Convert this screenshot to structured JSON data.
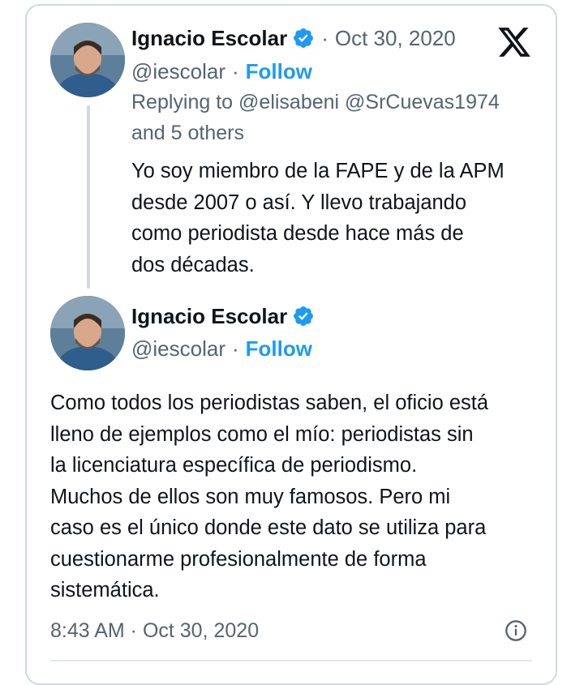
{
  "tweets": [
    {
      "author": {
        "name": "Ignacio Escolar",
        "handle": "@iescolar",
        "verified": true
      },
      "date": "Oct 30, 2020",
      "follow_label": "Follow",
      "reply": {
        "prefix": "Replying to",
        "mentions": "@elisabeni @SrCuevas1974",
        "others": "and 5 others"
      },
      "text_lines": [
        "Yo soy miembro de la FAPE y de la APM",
        "desde 2007 o así. Y llevo trabajando",
        "como periodista desde hace más de",
        "dos décadas."
      ]
    },
    {
      "author": {
        "name": "Ignacio Escolar",
        "handle": "@iescolar",
        "verified": true
      },
      "follow_label": "Follow",
      "text_lines": [
        "Como todos los periodistas saben, el oficio está",
        "lleno de ejemplos como el mío: periodistas sin",
        "la licenciatura específica de periodismo.",
        "Muchos de ellos son muy famosos. Pero mi",
        "caso es el único donde este dato se utiliza para",
        "cuestionarme profesionalmente de forma",
        "sistemática."
      ],
      "timestamp": "8:43 AM · Oct 30, 2020"
    }
  ],
  "icons": {
    "brand": "x-logo-icon",
    "verified": "verified-badge-icon",
    "info": "info-icon"
  },
  "colors": {
    "accent": "#1d9bf0",
    "secondary_text": "#536471",
    "primary_text": "#0f1419",
    "border": "#cfd9de"
  },
  "separator": "·"
}
